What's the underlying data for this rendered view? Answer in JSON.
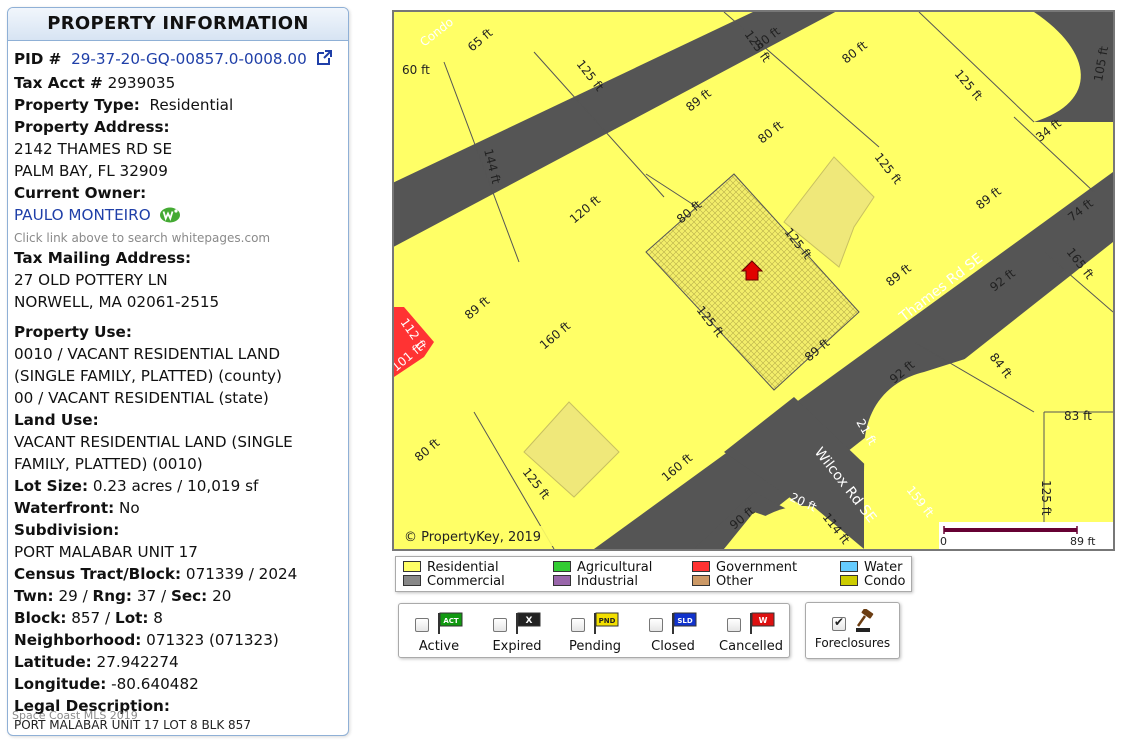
{
  "panel": {
    "title": "PROPERTY INFORMATION",
    "pid_label": "PID #",
    "pid_value": "29-37-20-GQ-00857.0-0008.00",
    "tax_acct_label": "Tax Acct #",
    "tax_acct_value": "2939035",
    "property_type_label": "Property Type:",
    "property_type_value": "Residential",
    "property_address_label": "Property Address:",
    "address_line1": "2142 THAMES RD SE",
    "address_line2": "PALM BAY, FL 32909",
    "current_owner_label": "Current Owner:",
    "owner_name": "PAULO MONTEIRO",
    "owner_hint": "Click link above to search whitepages.com",
    "mailing_label": "Tax Mailing Address:",
    "mailing_line1": "27 OLD POTTERY LN",
    "mailing_line2": "NORWELL, MA 02061-2515",
    "property_use_label": "Property Use:",
    "property_use_line1": "0010 / VACANT RESIDENTIAL LAND",
    "property_use_line2": "(SINGLE FAMILY, PLATTED) (county)",
    "property_use_line3": "00 / VACANT RESIDENTIAL (state)",
    "land_use_label": "Land Use:",
    "land_use_line1": "VACANT RESIDENTIAL LAND (SINGLE",
    "land_use_line2": "FAMILY, PLATTED) (0010)",
    "lot_size_label": "Lot Size:",
    "lot_size_value": "0.23 acres / 10,019 sf",
    "waterfront_label": "Waterfront:",
    "waterfront_value": "No",
    "subdivision_label": "Subdivision:",
    "subdivision_value": "PORT MALABAR UNIT 17",
    "census_label": "Census Tract/Block:",
    "census_value": "071339 / 2024",
    "twn_label": "Twn:",
    "twn_value": "29",
    "rng_label": "Rng:",
    "rng_value": "37",
    "sec_label": "Sec:",
    "sec_value": "20",
    "block_label": "Block:",
    "block_value": "857",
    "lot_label": "Lot:",
    "lot_value": "8",
    "neighborhood_label": "Neighborhood:",
    "neighborhood_value": "071323 (071323)",
    "latitude_label": "Latitude:",
    "latitude_value": "27.942274",
    "longitude_label": "Longitude:",
    "longitude_value": "-80.640482",
    "legal_label": "Legal Description:",
    "legal_value": "PORT MALABAR UNIT 17 LOT 8 BLK 857",
    "credit_overlay": "Space Coast MLS 2019"
  },
  "map": {
    "copyright": "© PropertyKey, 2019",
    "scale_start": "0",
    "scale_end": "89 ft",
    "streets": {
      "thames": "Thames Rd SE",
      "wilcox": "Wilcox Rd SE",
      "condo_fragment": "Condo"
    },
    "dimensions": {
      "d1": "65 ft",
      "d2": "60 ft",
      "d3": "125 ft",
      "d4": "80 ft",
      "d5": "80 ft",
      "d6": "125 ft",
      "d7": "105 ft",
      "d8": "125 ft",
      "d9": "89 ft",
      "d10": "80 ft",
      "d11": "125 ft",
      "d12": "34 ft",
      "d13": "144 ft",
      "d14": "120 ft",
      "d15": "80 ft",
      "d16": "89 ft",
      "d17": "74 ft",
      "d18": "125 ft",
      "d19": "89 ft",
      "d20": "165 ft",
      "d21": "92 ft",
      "d22": "112 ft",
      "d23": "101 ft",
      "d24": "89 ft",
      "d25": "160 ft",
      "d26": "125 ft",
      "d27": "89 ft",
      "d28": "92 ft",
      "d29": "84 ft",
      "d30": "83 ft",
      "d31": "80 ft",
      "d32": "21 ft",
      "d33": "125 ft",
      "d34": "160 ft",
      "d35": "125 ft",
      "d36": "159 ft",
      "d37": "20 ft",
      "d38": "90 ft",
      "d39": "114 ft"
    }
  },
  "legend": {
    "residential": "Residential",
    "commercial": "Commercial",
    "agricultural": "Agricultural",
    "industrial": "Industrial",
    "government": "Government",
    "other": "Other",
    "water": "Water",
    "condo": "Condo"
  },
  "colors": {
    "residential": "#ffff66",
    "commercial": "#888888",
    "agricultural": "#33cc33",
    "industrial": "#9966aa",
    "government": "#ff3333",
    "other": "#cc9966",
    "water": "#66ccff",
    "condo": "#cccc00",
    "road": "#555555",
    "pid_link": "#1f3fa8"
  },
  "status": {
    "active": "Active",
    "active_flag": "ACT",
    "expired": "Expired",
    "expired_flag": "X",
    "pending": "Pending",
    "pending_flag": "PND",
    "closed": "Closed",
    "closed_flag": "SLD",
    "cancelled": "Cancelled",
    "cancelled_flag": "W",
    "foreclosures": "Foreclosures"
  },
  "icons": {
    "external": "external-link-icon",
    "whitepages": "whitepages-icon",
    "marker": "house-marker-icon",
    "gavel": "gavel-icon"
  }
}
